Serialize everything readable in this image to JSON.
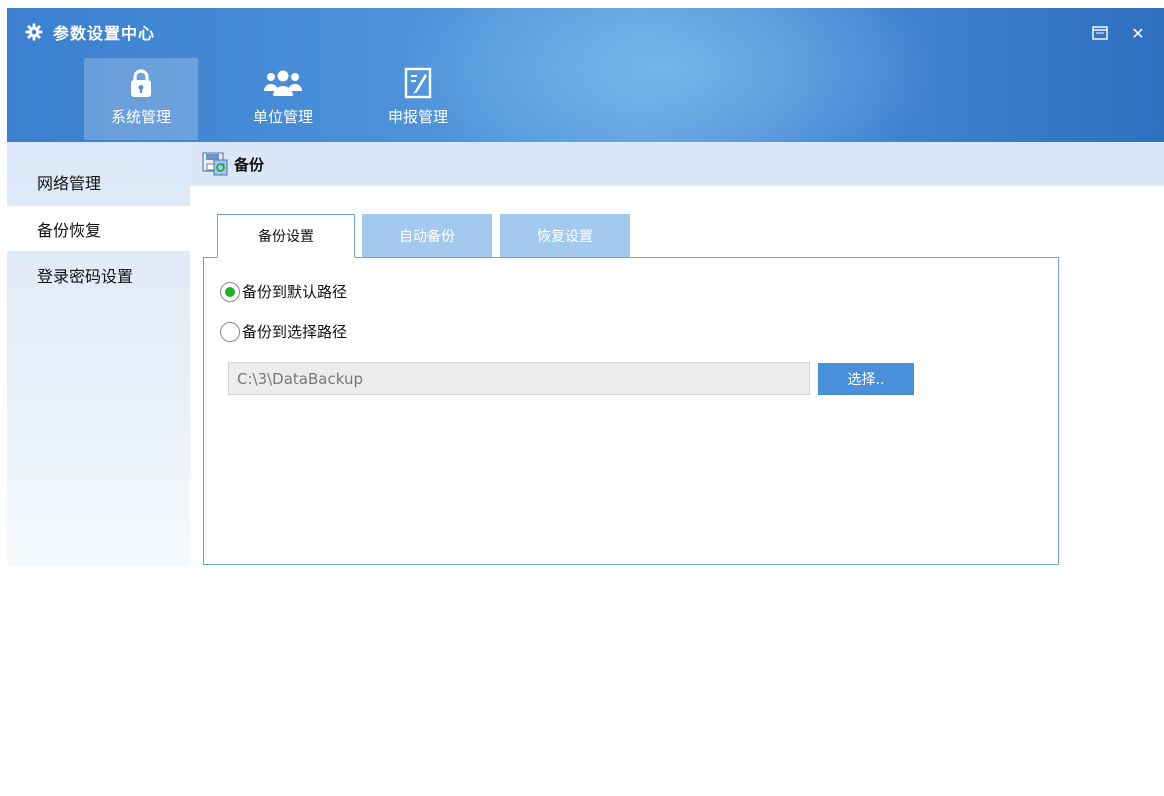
{
  "window": {
    "title": "参数设置中心",
    "title_icon": "gear-icon",
    "maximize_icon": "maximize-icon",
    "close_glyph": "✕"
  },
  "nav": {
    "items": [
      {
        "label": "系统管理",
        "icon": "lock-icon",
        "active": true
      },
      {
        "label": "单位管理",
        "icon": "users-icon",
        "active": false
      },
      {
        "label": "申报管理",
        "icon": "edit-document-icon",
        "active": false
      }
    ]
  },
  "sidebar": {
    "items": [
      {
        "label": "网络管理",
        "active": false
      },
      {
        "label": "备份恢复",
        "active": true
      },
      {
        "label": "登录密码设置",
        "active": false
      }
    ]
  },
  "section": {
    "title": "备份",
    "icon": "backup-icon"
  },
  "tabs": [
    {
      "label": "备份设置",
      "active": true
    },
    {
      "label": "自动备份",
      "active": false
    },
    {
      "label": "恢复设置",
      "active": false
    }
  ],
  "backup_settings": {
    "option_default": {
      "label": "备份到默认路径",
      "checked": true
    },
    "option_custom": {
      "label": "备份到选择路径",
      "checked": false
    },
    "path_value": "C:\\3\\DataBackup",
    "choose_button_label": "选择.."
  },
  "colors": {
    "header_blue": "#3b7fd0",
    "sidebar_bg": "#dbe8f7",
    "tab_inactive": "#a4c9ee",
    "panel_border": "#6aa2de",
    "radio_checked": "#1db41d",
    "button_blue": "#4a8fd9"
  }
}
